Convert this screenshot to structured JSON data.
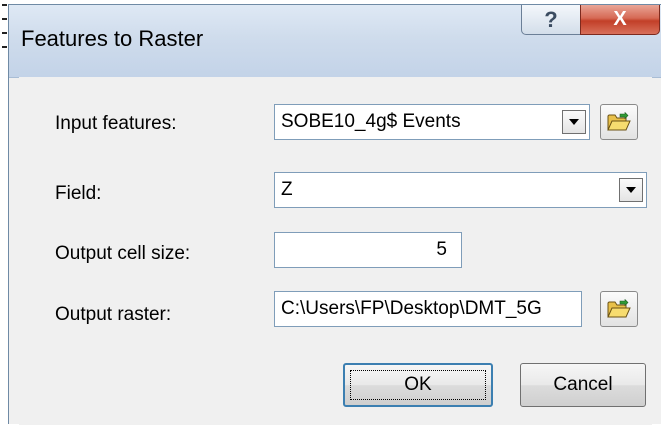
{
  "window": {
    "title": "Features to Raster",
    "help_label": "?",
    "close_label": "X"
  },
  "form": {
    "input_features": {
      "label": "Input features:",
      "value": "SOBE10_4g$ Events"
    },
    "field": {
      "label": "Field:",
      "value": "Z"
    },
    "output_cell_size": {
      "label": "Output cell size:",
      "value": "5"
    },
    "output_raster": {
      "label": "Output raster:",
      "value": "C:\\Users\\FP\\Desktop\\DMT_5G"
    }
  },
  "buttons": {
    "ok_label": "OK",
    "cancel_label": "Cancel"
  },
  "icons": {
    "browse": "open-folder-icon",
    "dropdown": "chevron-down-icon"
  }
}
